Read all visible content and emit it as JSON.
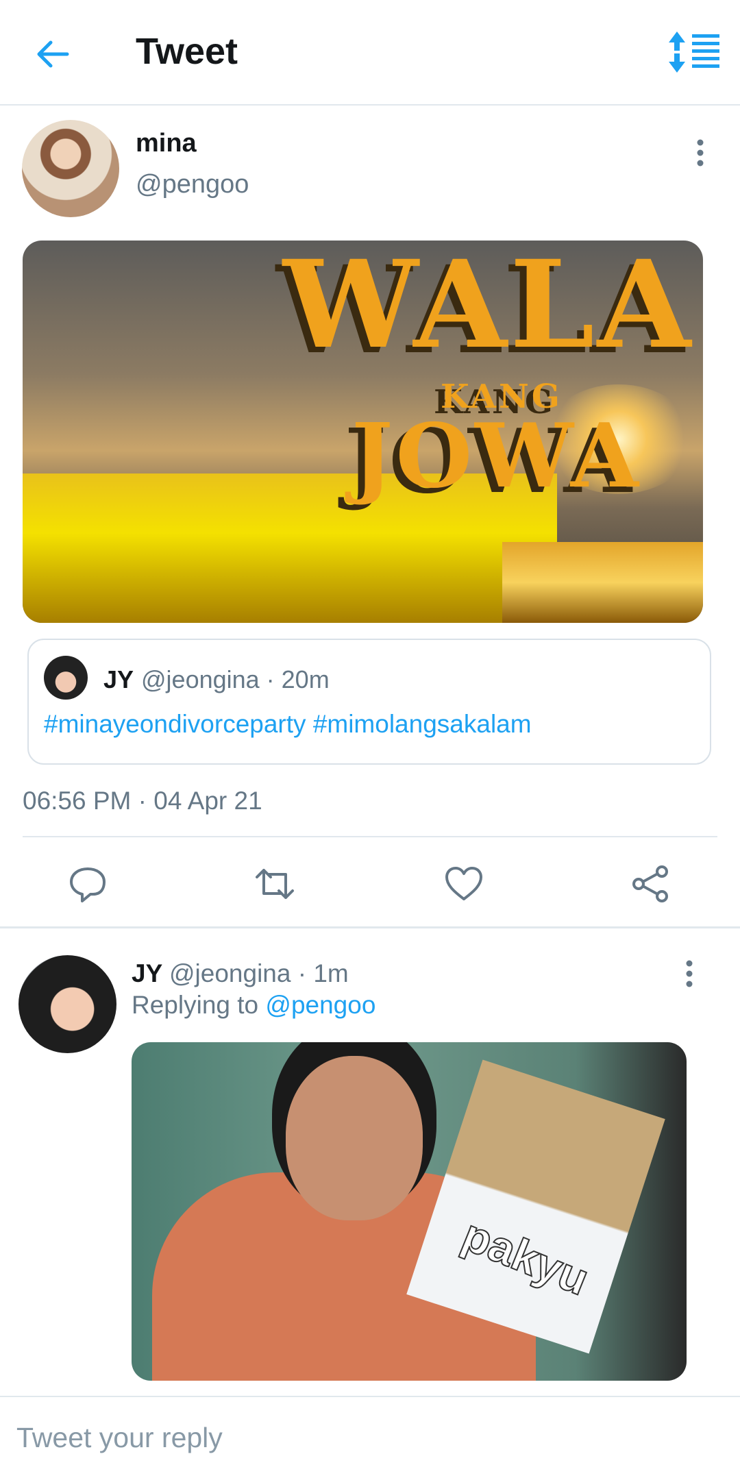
{
  "header": {
    "title": "Tweet",
    "back_icon": "arrow-left-icon",
    "sort_icon": "sort-icon",
    "accent": "#1da1f2"
  },
  "main_tweet": {
    "name": "mina",
    "handle": "@pengoo",
    "more_icon": "more-vertical-icon",
    "media_text": {
      "line1": "WALA",
      "line2": "KANG",
      "line3": "JOWA"
    },
    "quoted": {
      "name": "JY",
      "handle_time": "@jeongina · 20m",
      "text": "#minayeondivorceparty #mimolangsakalam"
    },
    "timestamp": "06:56 PM · 04 Apr 21",
    "actions": [
      "reply-icon",
      "retweet-icon",
      "like-icon",
      "share-icon"
    ]
  },
  "reply_tweet": {
    "name": "JY",
    "handle_time": "@jeongina · 1m",
    "replying_prefix": "Replying to",
    "replying_handle": "@pengoo",
    "more_icon": "more-vertical-icon",
    "media_text": "pakyu"
  },
  "composer": {
    "placeholder": "Tweet your reply"
  }
}
